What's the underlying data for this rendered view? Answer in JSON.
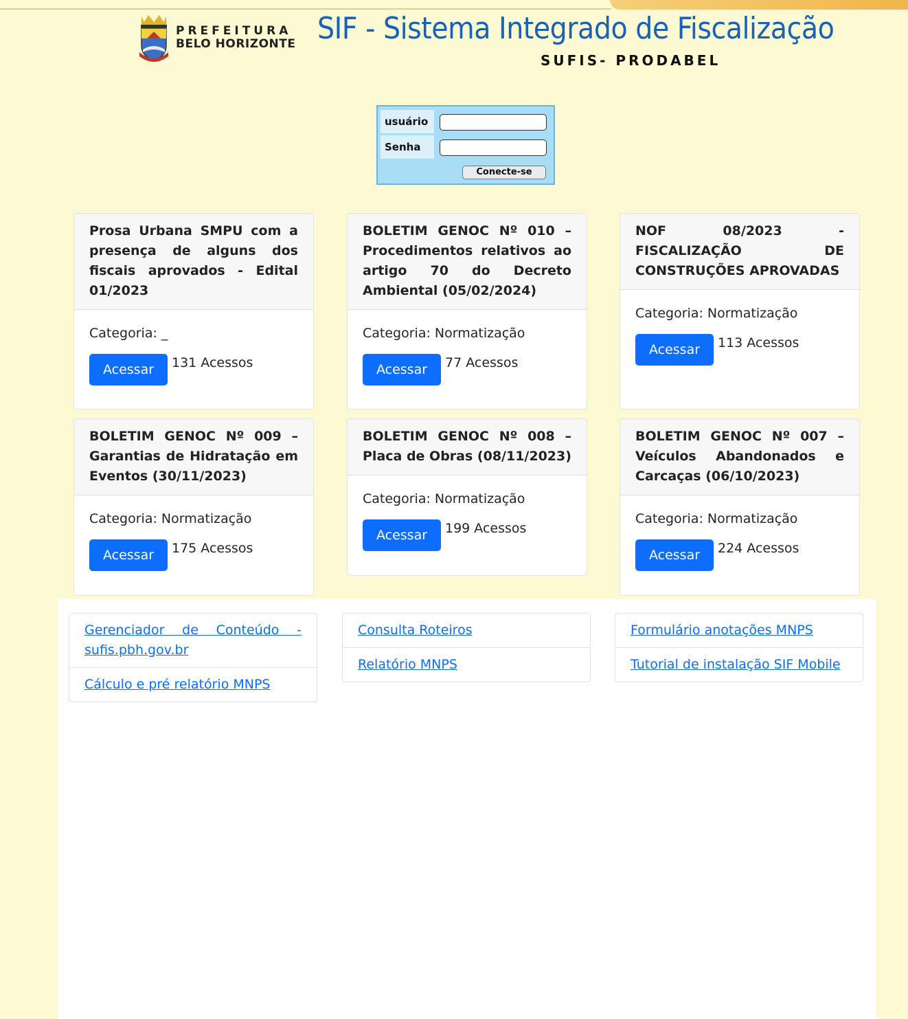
{
  "header": {
    "pref_line1": "PREFEITURA",
    "pref_line2": "BELO HORIZONTE",
    "title": "SIF - Sistema Integrado de Fiscalização",
    "subtitle": "SUFIS- PRODABEL",
    "title_color": "#1762b8"
  },
  "login": {
    "user_label": "usuário",
    "password_label": "Senha",
    "user_value": "",
    "password_value": "",
    "submit_label": "Conecte-se"
  },
  "cards": [
    {
      "title": "Prosa Urbana SMPU com a presença de alguns dos fiscais aprovados - Edital 01/2023",
      "category": "Categoria: _",
      "button": "Acessar",
      "accesses": "131 Acessos"
    },
    {
      "title": "BOLETIM GENOC Nº 010 – Procedimentos relativos ao artigo 70 do Decreto Ambiental (05/02/2024)",
      "category": "Categoria: Normatização",
      "button": "Acessar",
      "accesses": "77 Acessos"
    },
    {
      "title": "NOF 08/2023 - FISCALIZAÇÃO DE CONSTRUÇÕES APROVADAS",
      "category": "Categoria: Normatização",
      "button": "Acessar",
      "accesses": "113 Acessos"
    },
    {
      "title": "BOLETIM GENOC Nº 009 – Garantias de Hidratação em Eventos (30/11/2023)",
      "category": "Categoria: Normatização",
      "button": "Acessar",
      "accesses": "175 Acessos"
    },
    {
      "title": "BOLETIM GENOC Nº 008 – Placa de Obras (08/11/2023)",
      "category": "Categoria: Normatização",
      "button": "Acessar",
      "accesses": "199 Acessos"
    },
    {
      "title": "BOLETIM GENOC Nº 007 – Veículos Abandonados e Carcaças (06/10/2023)",
      "category": "Categoria: Normatização",
      "button": "Acessar",
      "accesses": "224 Acessos"
    }
  ],
  "link_groups": [
    [
      "Gerenciador de Conteúdo - sufis.pbh.gov.br",
      "Cálculo e pré relatório MNPS"
    ],
    [
      "Consulta Roteiros",
      "Relatório MNPS"
    ],
    [
      "Formulário anotações MNPS",
      "Tutorial de instalação SIF Mobile"
    ]
  ],
  "colors": {
    "background": "#fdf9d2",
    "login_bg": "#a9dcf5",
    "primary_button": "#0d6efd",
    "link": "#0d6efd"
  }
}
